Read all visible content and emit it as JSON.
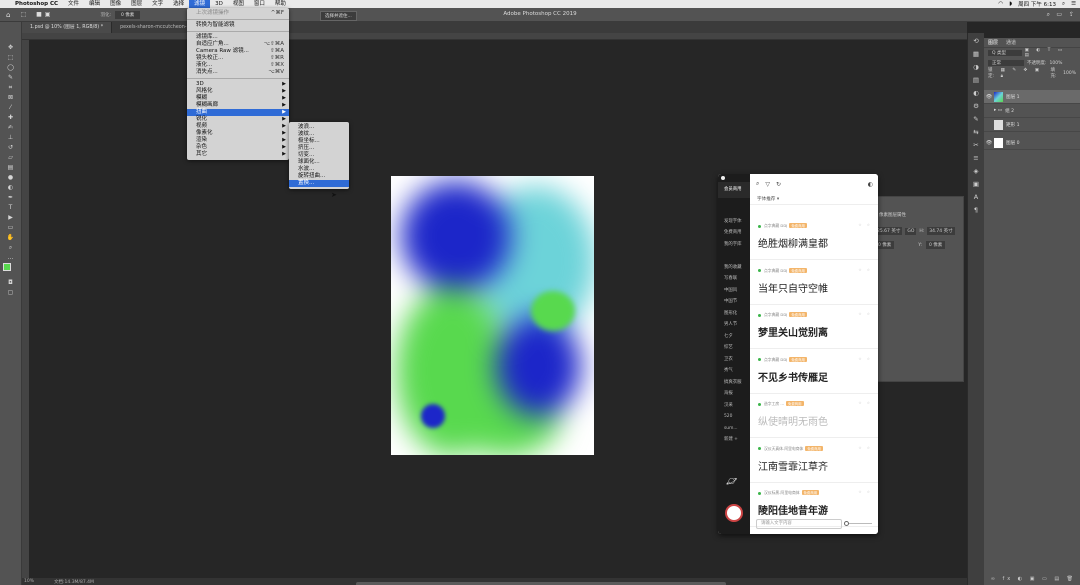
{
  "menubar": {
    "apple": "",
    "app_name": "Photoshop CC",
    "items": [
      "文件",
      "编辑",
      "图像",
      "图层",
      "文字",
      "选择",
      "滤镜",
      "3D",
      "视图",
      "窗口",
      "帮助"
    ],
    "active_index": 6,
    "clock": "周四 下午 6:13"
  },
  "window": {
    "title": "Adobe Photoshop CC 2019"
  },
  "options": {
    "feather_label": "羽化:",
    "feather_value": "0 像素",
    "select_mask": "选择并遮住..."
  },
  "tabs": [
    {
      "label": "1.psd @ 10% (图层 1, RGB/8) *"
    },
    {
      "label": "pexels-sharon-mccutcheon-..."
    }
  ],
  "status": {
    "zoom": "10%",
    "doc": "文档:14.3M/87.4M"
  },
  "filter_menu": {
    "items": [
      {
        "label": "上次滤镜操作",
        "shortcut": "^⌘F",
        "disabled": true
      },
      {
        "sep": true
      },
      {
        "label": "转换为智能滤镜"
      },
      {
        "sep": true
      },
      {
        "label": "滤镜库..."
      },
      {
        "label": "自适应广角...",
        "shortcut": "⌥⇧⌘A"
      },
      {
        "label": "Camera Raw 滤镜...",
        "shortcut": "⇧⌘A"
      },
      {
        "label": "镜头校正...",
        "shortcut": "⇧⌘R"
      },
      {
        "label": "液化...",
        "shortcut": "⇧⌘X"
      },
      {
        "label": "消失点...",
        "shortcut": "⌥⌘V"
      },
      {
        "sep": true
      },
      {
        "label": "3D",
        "submenu": true
      },
      {
        "label": "风格化",
        "submenu": true
      },
      {
        "label": "模糊",
        "submenu": true
      },
      {
        "label": "模糊画廊",
        "submenu": true
      },
      {
        "label": "扭曲",
        "submenu": true,
        "highlight": true
      },
      {
        "label": "锐化",
        "submenu": true
      },
      {
        "label": "视频",
        "submenu": true
      },
      {
        "label": "像素化",
        "submenu": true
      },
      {
        "label": "渲染",
        "submenu": true
      },
      {
        "label": "杂色",
        "submenu": true
      },
      {
        "label": "其它",
        "submenu": true
      }
    ]
  },
  "distort_submenu": {
    "items": [
      {
        "label": "波浪..."
      },
      {
        "label": "波纹..."
      },
      {
        "label": "极坐标..."
      },
      {
        "label": "挤压..."
      },
      {
        "label": "切变..."
      },
      {
        "label": "球面化..."
      },
      {
        "label": "水波..."
      },
      {
        "label": "旋转扭曲..."
      },
      {
        "label": "置换...",
        "highlight": true
      }
    ]
  },
  "layers_panel": {
    "tabs": [
      "图层",
      "通道"
    ],
    "kind": "Q 类型",
    "blend": "正常",
    "opacity_label": "不透明度:",
    "opacity": "100%",
    "lock_label": "锁定:",
    "fill_label": "填充:",
    "fill": "100%",
    "layers": [
      {
        "name": "图层 1",
        "visible": true,
        "selected": true
      },
      {
        "name": "组 2",
        "visible": false,
        "group": true
      },
      {
        "name": "矩形 1",
        "visible": false
      },
      {
        "name": "图层 0",
        "visible": true
      }
    ]
  },
  "props_panel": {
    "title": "像素图层属性",
    "w_label": "W:",
    "w": "25.67 英寸",
    "go": "GO",
    "h_label": "H:",
    "h": "34.74 英寸",
    "x_label": "X:",
    "x": "0 像素",
    "y_label": "Y:",
    "y": "0 像素"
  },
  "font_panel": {
    "sidebar": [
      "会员商用",
      "",
      "发现字体",
      "免费商用",
      "我的字库",
      "",
      "我的收藏",
      "写春联",
      "中国风",
      "中国节",
      "图形化",
      "男人节",
      "七夕",
      "综艺",
      "卫衣",
      "秀气",
      "搞爽衣服",
      "海报",
      "汉采",
      "520",
      "sum...",
      "新建 +"
    ],
    "recommend_label": "字体推荐",
    "fonts": [
      {
        "meta": "点字典藏 DDJ",
        "badge": "免费商用",
        "sample": "绝胜烟柳满皇都"
      },
      {
        "meta": "点字典藏 DDJ",
        "badge": "免费商用",
        "sample": "当年只自守空帷"
      },
      {
        "meta": "点字典藏 DDJ",
        "badge": "免费商用",
        "sample": "梦里关山觉别离"
      },
      {
        "meta": "点字典藏 DDJ",
        "badge": "免费商用",
        "sample": "不见乡书传雁足"
      },
      {
        "meta": "造字工房 ...",
        "badge": "免费商用",
        "sample": "纵使晴明无雨色"
      },
      {
        "meta": "汉仪天真体-阿里电商体",
        "badge": "免费商用",
        "sample": "江南雪霏江草齐"
      },
      {
        "meta": "汉仪标黑-阿里电商体",
        "badge": "免费商用",
        "sample": "陵阳佳地昔年游"
      }
    ],
    "input_placeholder": "请输入文字内容"
  },
  "colors": {
    "blob_blue": "#1c26c9",
    "blob_cyan": "#6cd3d9",
    "blob_green": "#58d94e",
    "accent": "#2f6bd6"
  }
}
